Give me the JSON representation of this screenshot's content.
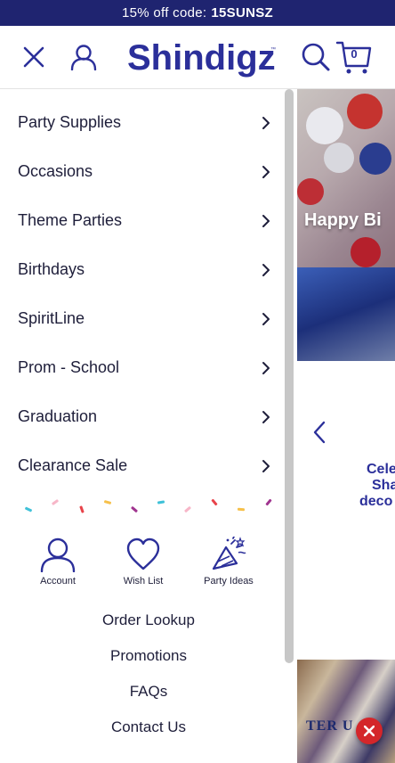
{
  "promo": {
    "text": "15% off code:",
    "code": "15SUNSZ"
  },
  "header": {
    "logo_text": "Shindigz",
    "cart_count": "0"
  },
  "menu": {
    "items": [
      {
        "label": "Party Supplies"
      },
      {
        "label": "Occasions"
      },
      {
        "label": "Theme Parties"
      },
      {
        "label": "Birthdays"
      },
      {
        "label": "SpiritLine"
      },
      {
        "label": "Prom - School"
      },
      {
        "label": "Graduation"
      },
      {
        "label": "Clearance Sale"
      }
    ],
    "quick_links": [
      {
        "label": "Account",
        "icon": "account-icon"
      },
      {
        "label": "Wish List",
        "icon": "heart-icon"
      },
      {
        "label": "Party Ideas",
        "icon": "party-hat-icon"
      }
    ],
    "utility_links": [
      {
        "label": "Order Lookup"
      },
      {
        "label": "Promotions"
      },
      {
        "label": "FAQs"
      },
      {
        "label": "Contact Us"
      }
    ]
  },
  "background": {
    "hero_text": "Happy Bi",
    "slide_caption": [
      "Cele",
      "Sha",
      "deco"
    ],
    "photo_text": "TER U"
  },
  "colors": {
    "brand": "#2b2f9a",
    "promo_bg": "#1f2470",
    "close_red": "#d4262a"
  }
}
